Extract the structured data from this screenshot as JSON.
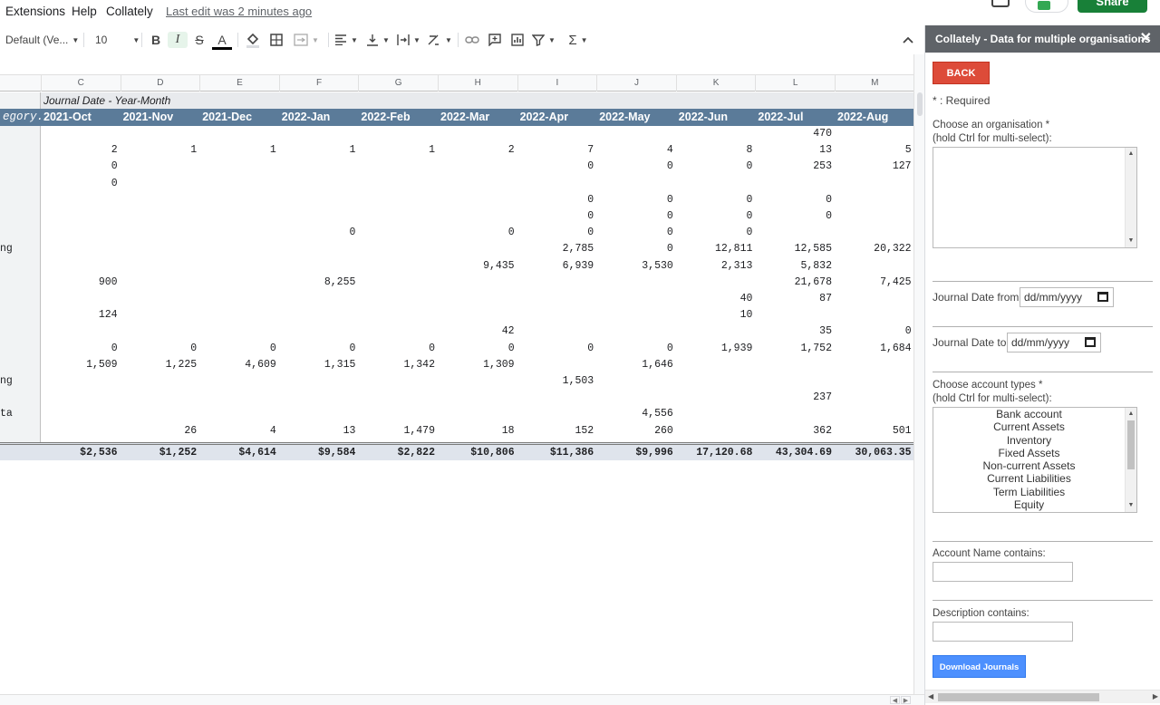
{
  "menu": {
    "items": [
      "Extensions",
      "Help",
      "Collately"
    ],
    "last_edit": "Last edit was 2 minutes ago"
  },
  "topbar": {
    "share_label": "Share"
  },
  "toolbar": {
    "font": "Default (Ve...",
    "font_size": "10",
    "icons": [
      "bold-icon",
      "italic-icon",
      "strikethrough-icon",
      "text-color-icon",
      "fill-color-icon",
      "borders-icon",
      "merge-cells-icon",
      "align-left-icon",
      "vertical-align-icon",
      "text-wrap-icon",
      "text-rotate-icon",
      "link-icon",
      "comment-icon",
      "chart-icon",
      "filter-icon",
      "functions-icon",
      "collapse-icon"
    ],
    "bold": "B",
    "italic": "I",
    "strike": "S",
    "text_color": "A"
  },
  "grid": {
    "column_letters": [
      "C",
      "D",
      "E",
      "F",
      "G",
      "H",
      "I",
      "J",
      "K",
      "L",
      "M"
    ],
    "pivot_title": "Journal Date - Year-Month",
    "row_header_label": "egory.C",
    "months": [
      "2021-Oct",
      "2021-Nov",
      "2021-Dec",
      "2022-Jan",
      "2022-Feb",
      "2022-Mar",
      "2022-Apr",
      "2022-May",
      "2022-Jun",
      "2022-Jul",
      "2022-Aug"
    ],
    "row_labels": [
      "",
      "",
      "",
      "",
      "",
      "",
      "",
      "ng",
      "",
      "",
      "",
      "",
      "",
      "",
      "",
      "ng",
      "",
      "ta",
      ""
    ],
    "rows": [
      [
        "",
        "",
        "",
        "",
        "",
        "",
        "",
        "",
        "",
        "470",
        ""
      ],
      [
        "2",
        "1",
        "1",
        "1",
        "1",
        "2",
        "7",
        "4",
        "8",
        "13",
        "5"
      ],
      [
        "0",
        "",
        "",
        "",
        "",
        "",
        "0",
        "0",
        "0",
        "253",
        "127"
      ],
      [
        "0",
        "",
        "",
        "",
        "",
        "",
        "",
        "",
        "",
        "",
        ""
      ],
      [
        "",
        "",
        "",
        "",
        "",
        "",
        "0",
        "0",
        "0",
        "0",
        ""
      ],
      [
        "",
        "",
        "",
        "",
        "",
        "",
        "0",
        "0",
        "0",
        "0",
        ""
      ],
      [
        "",
        "",
        "",
        "0",
        "",
        "0",
        "0",
        "0",
        "0",
        "",
        ""
      ],
      [
        "",
        "",
        "",
        "",
        "",
        "",
        "2,785",
        "0",
        "12,811",
        "12,585",
        "20,322"
      ],
      [
        "",
        "",
        "",
        "",
        "",
        "9,435",
        "6,939",
        "3,530",
        "2,313",
        "5,832",
        ""
      ],
      [
        "900",
        "",
        "",
        "8,255",
        "",
        "",
        "",
        "",
        "",
        "21,678",
        "7,425"
      ],
      [
        "",
        "",
        "",
        "",
        "",
        "",
        "",
        "",
        "40",
        "87",
        ""
      ],
      [
        "124",
        "",
        "",
        "",
        "",
        "",
        "",
        "",
        "10",
        "",
        ""
      ],
      [
        "",
        "",
        "",
        "",
        "",
        "42",
        "",
        "",
        "",
        "35",
        "0"
      ],
      [
        "0",
        "0",
        "0",
        "0",
        "0",
        "0",
        "0",
        "0",
        "1,939",
        "1,752",
        "1,684"
      ],
      [
        "1,509",
        "1,225",
        "4,609",
        "1,315",
        "1,342",
        "1,309",
        "",
        "1,646",
        "",
        "",
        ""
      ],
      [
        "",
        "",
        "",
        "",
        "",
        "",
        "1,503",
        "",
        "",
        "",
        ""
      ],
      [
        "",
        "",
        "",
        "",
        "",
        "",
        "",
        "",
        "",
        "237",
        ""
      ],
      [
        "",
        "",
        "",
        "",
        "",
        "",
        "",
        "4,556",
        "",
        "",
        ""
      ],
      [
        "",
        "26",
        "4",
        "13",
        "1,479",
        "18",
        "152",
        "260",
        "",
        "362",
        "501"
      ]
    ],
    "totals": [
      "$2,536",
      "$1,252",
      "$4,614",
      "$9,584",
      "$2,822",
      "$10,806",
      "$11,386",
      "$9,996",
      "17,120.68",
      "43,304.69",
      "30,063.35"
    ]
  },
  "sidebar": {
    "title": "Collately - Data for multiple organisations",
    "back_label": "BACK",
    "required_note": "* : Required",
    "org_label": "Choose an organisation *",
    "org_hint": "(hold Ctrl for multi-select):",
    "date_from_label": "Journal Date from:",
    "date_to_label": "Journal Date to:",
    "date_placeholder": "dd/mm/yyyy",
    "account_types_label": "Choose account types *",
    "account_types_hint": "(hold Ctrl for multi-select):",
    "account_types": [
      "Bank account",
      "Current Assets",
      "Inventory",
      "Fixed Assets",
      "Non-current Assets",
      "Current Liabilities",
      "Term Liabilities",
      "Equity"
    ],
    "account_name_label": "Account Name contains:",
    "description_label": "Description contains:",
    "download_label": "Download Journals"
  }
}
